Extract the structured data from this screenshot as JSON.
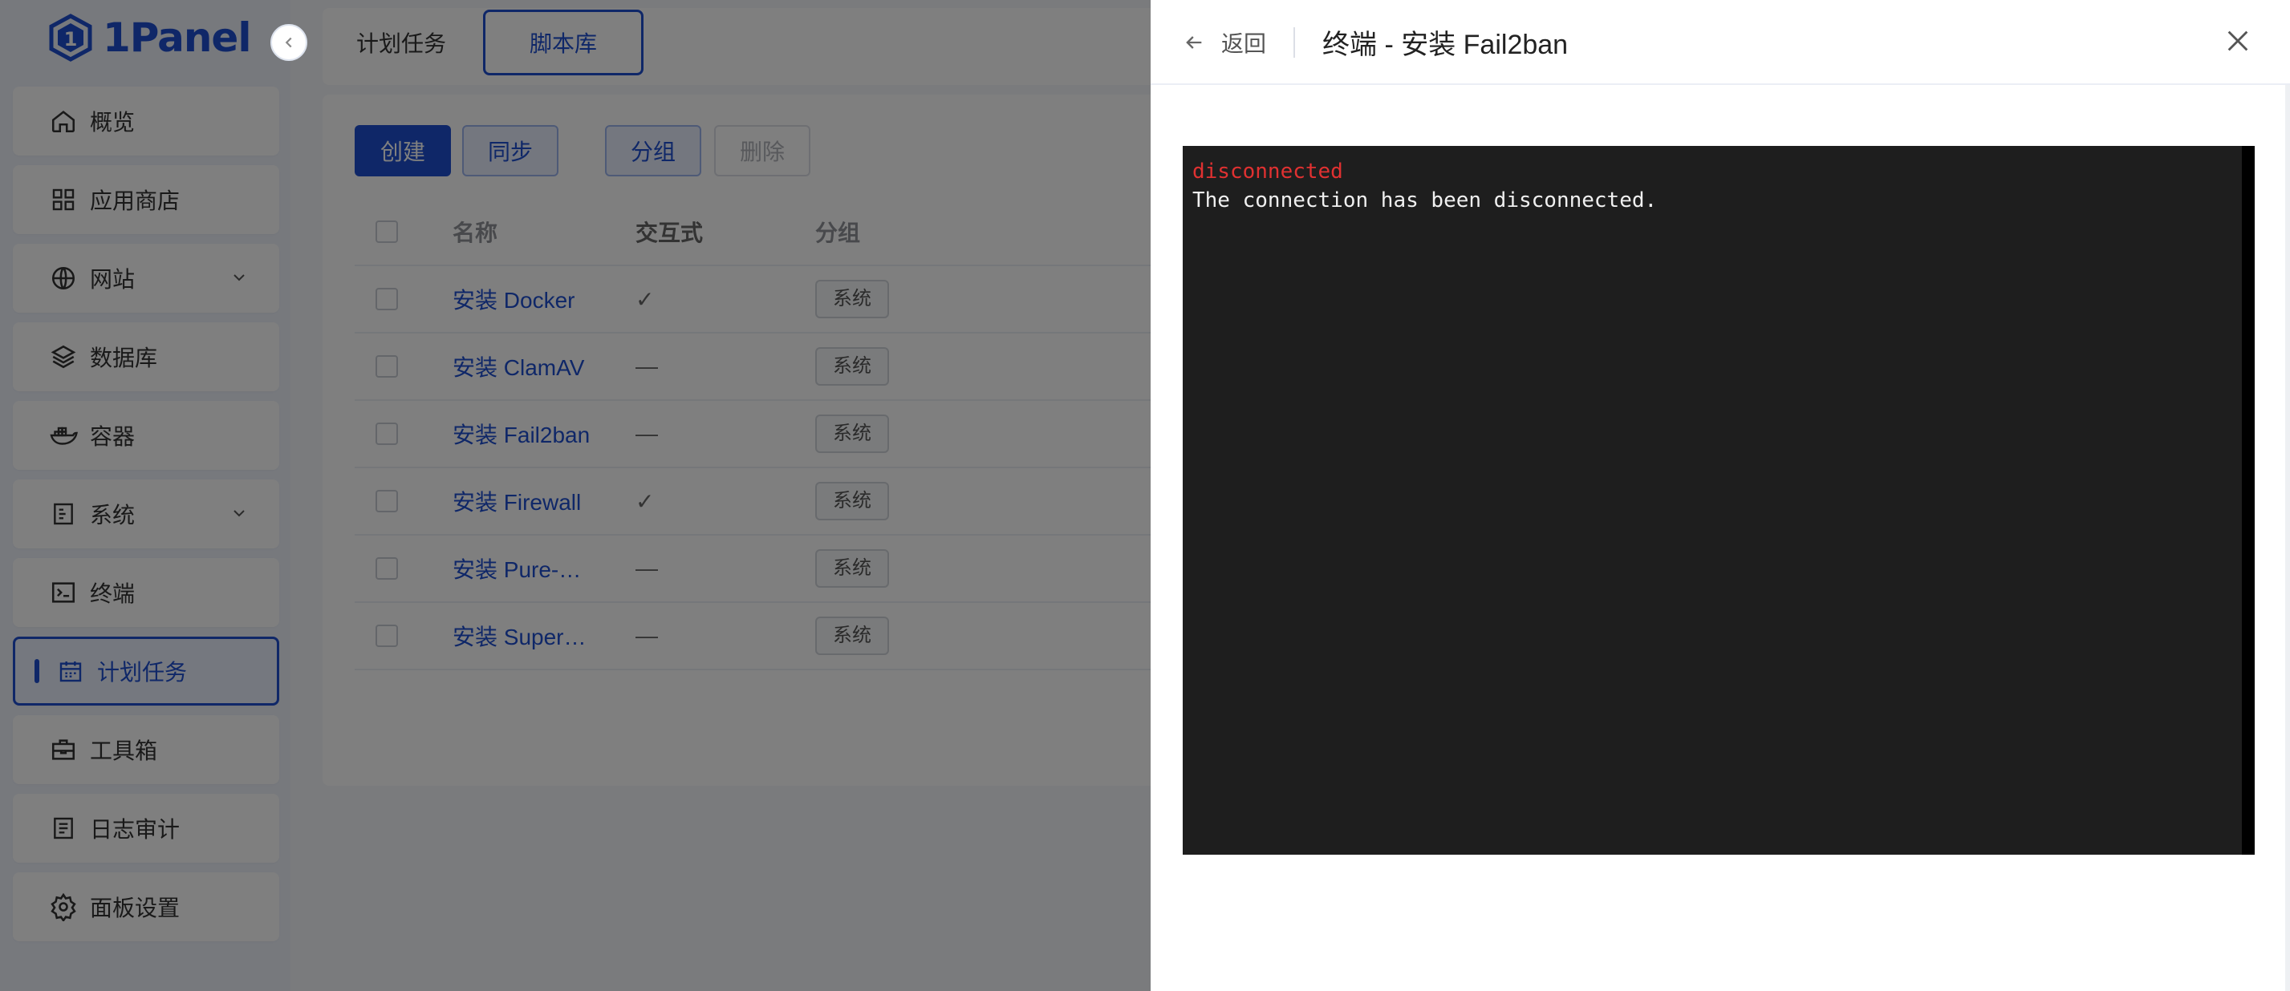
{
  "brand": {
    "name": "1Panel",
    "color": "#1e4fd0"
  },
  "sidebar": {
    "items": [
      {
        "label": "概览",
        "icon": "home-icon"
      },
      {
        "label": "应用商店",
        "icon": "grid-icon"
      },
      {
        "label": "网站",
        "icon": "globe-icon",
        "expandable": true
      },
      {
        "label": "数据库",
        "icon": "layers-icon"
      },
      {
        "label": "容器",
        "icon": "docker-icon"
      },
      {
        "label": "系统",
        "icon": "server-icon",
        "expandable": true
      },
      {
        "label": "终端",
        "icon": "terminal-icon"
      },
      {
        "label": "计划任务",
        "icon": "calendar-icon",
        "active": true
      },
      {
        "label": "工具箱",
        "icon": "toolbox-icon"
      },
      {
        "label": "日志审计",
        "icon": "log-icon"
      },
      {
        "label": "面板设置",
        "icon": "gear-icon"
      }
    ]
  },
  "tabs": [
    {
      "label": "计划任务"
    },
    {
      "label": "脚本库",
      "active": true
    }
  ],
  "toolbar": {
    "create_label": "创建",
    "sync_label": "同步",
    "group_label": "分组",
    "delete_label": "删除"
  },
  "table": {
    "headers": {
      "name": "名称",
      "interactive": "交互式",
      "group": "分组"
    },
    "rows": [
      {
        "name": "安装 Docker",
        "interactive": "✓",
        "group": "系统"
      },
      {
        "name": "安装 ClamAV",
        "interactive": "—",
        "group": "系统"
      },
      {
        "name": "安装 Fail2ban",
        "interactive": "—",
        "group": "系统"
      },
      {
        "name": "安装 Firewall",
        "interactive": "✓",
        "group": "系统"
      },
      {
        "name": "安装 Pure-…",
        "interactive": "—",
        "group": "系统"
      },
      {
        "name": "安装 Super…",
        "interactive": "—",
        "group": "系统"
      }
    ]
  },
  "drawer": {
    "back_label": "返回",
    "title": "终端 - 安装 Fail2ban",
    "terminal": {
      "line1": "disconnected",
      "line2": "The connection has been disconnected."
    }
  }
}
